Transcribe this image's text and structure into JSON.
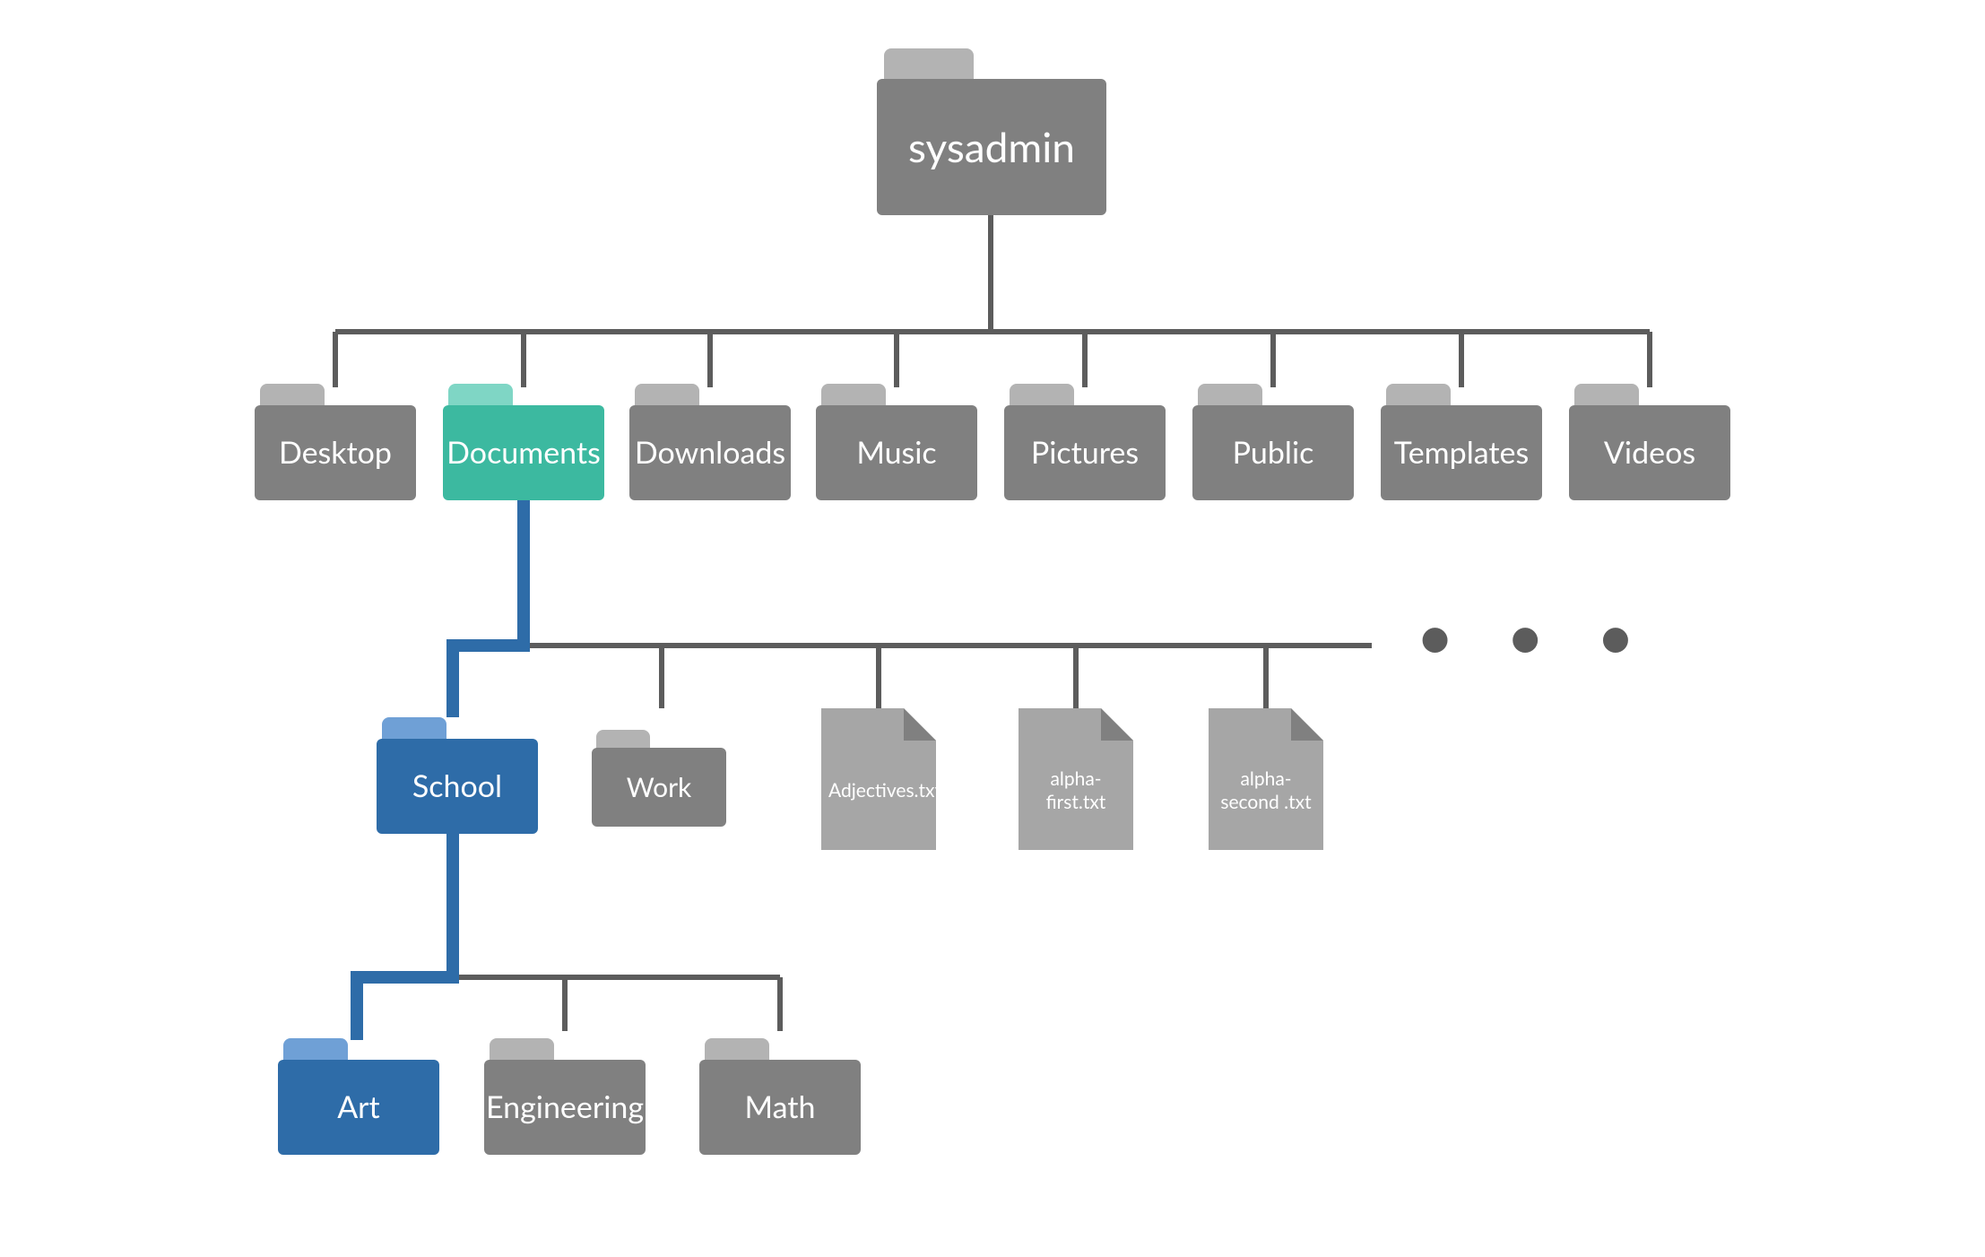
{
  "root": {
    "label": "sysadmin"
  },
  "level1": [
    {
      "label": "Desktop",
      "kind": "folder",
      "variant": "gray"
    },
    {
      "label": "Documents",
      "kind": "folder",
      "variant": "teal",
      "highlighted": true
    },
    {
      "label": "Downloads",
      "kind": "folder",
      "variant": "gray"
    },
    {
      "label": "Music",
      "kind": "folder",
      "variant": "gray"
    },
    {
      "label": "Pictures",
      "kind": "folder",
      "variant": "gray"
    },
    {
      "label": "Public",
      "kind": "folder",
      "variant": "gray"
    },
    {
      "label": "Templates",
      "kind": "folder",
      "variant": "gray"
    },
    {
      "label": "Videos",
      "kind": "folder",
      "variant": "gray"
    }
  ],
  "level2": [
    {
      "label": "School",
      "kind": "folder",
      "variant": "blue",
      "highlighted": true
    },
    {
      "label": "Work",
      "kind": "folder",
      "variant": "gray"
    },
    {
      "label": "Adjectives.txt",
      "kind": "file"
    },
    {
      "label": "alpha-first.txt",
      "kind": "file"
    },
    {
      "label": "alpha-second\n.txt",
      "kind": "file"
    }
  ],
  "level2_more": true,
  "ellipsis": "• • •",
  "level3": [
    {
      "label": "Art",
      "kind": "folder",
      "variant": "blue",
      "highlighted": true
    },
    {
      "label": "Engineering",
      "kind": "folder",
      "variant": "gray"
    },
    {
      "label": "Math",
      "kind": "folder",
      "variant": "gray"
    }
  ],
  "colors": {
    "line_default": "#5c5c5c",
    "line_highlight": "#2e6ca8",
    "folder_gray_tab": "#b3b3b3",
    "folder_gray_body": "#808080",
    "folder_teal_tab": "#7fd6c5",
    "folder_teal_body": "#3cb9a0",
    "folder_blue_tab": "#6fa0d6",
    "folder_blue_body": "#2e6ca8",
    "file_body": "#a6a6a6",
    "file_fold": "#808080"
  }
}
